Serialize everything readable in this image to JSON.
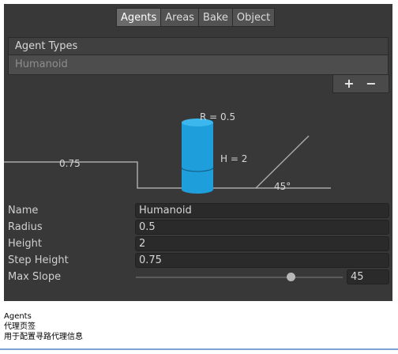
{
  "tabs": [
    {
      "label": "Agents",
      "active": true
    },
    {
      "label": "Areas",
      "active": false
    },
    {
      "label": "Bake",
      "active": false
    },
    {
      "label": "Object",
      "active": false
    }
  ],
  "agent_types": {
    "header": "Agent Types",
    "items": [
      "Humanoid"
    ],
    "add_label": "+",
    "remove_label": "−"
  },
  "diagram": {
    "radius_label": "R = 0.5",
    "height_label": "H = 2",
    "step_label": "0.75",
    "slope_label": "45°",
    "agent_color": "#1e9fdc"
  },
  "fields": {
    "name": {
      "label": "Name",
      "value": "Humanoid"
    },
    "radius": {
      "label": "Radius",
      "value": "0.5"
    },
    "height": {
      "label": "Height",
      "value": "2"
    },
    "step_height": {
      "label": "Step Height",
      "value": "0.75"
    },
    "max_slope": {
      "label": "Max Slope",
      "value": "45",
      "fraction": 0.75
    }
  },
  "caption": {
    "line1": "Agents",
    "line2": "代理页签",
    "line3": "用于配置寻路代理信息"
  }
}
